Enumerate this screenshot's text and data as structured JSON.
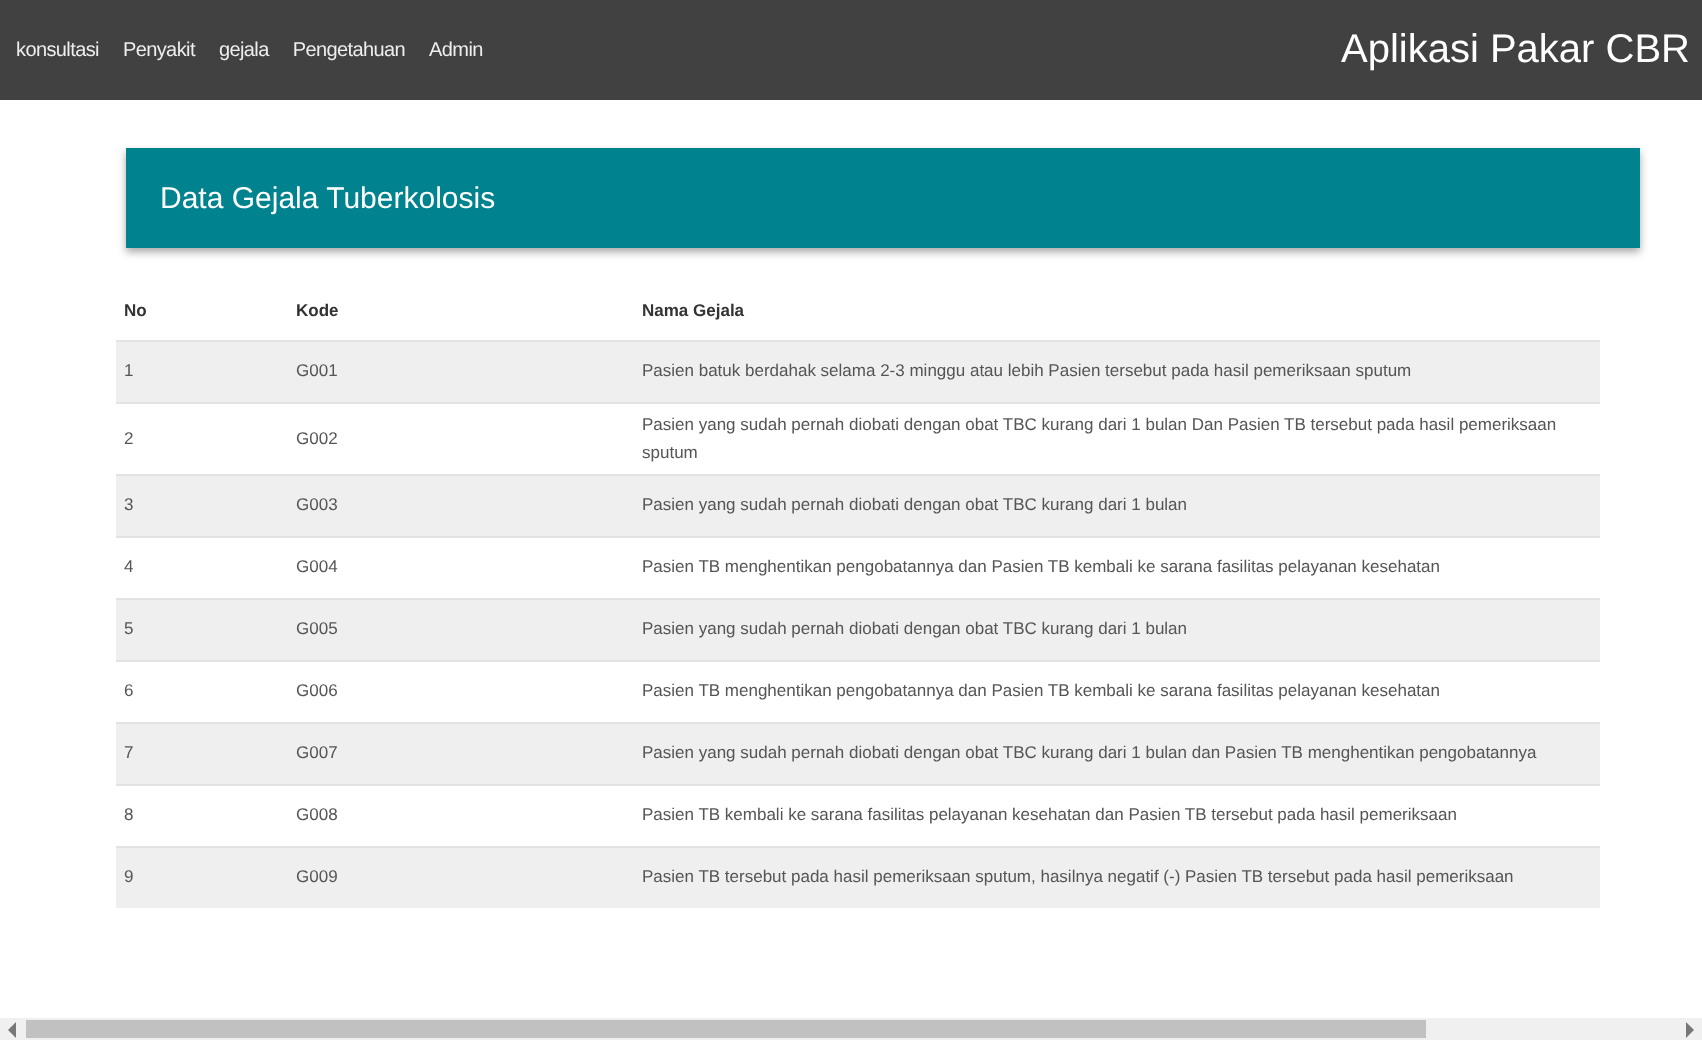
{
  "navbar": {
    "links": [
      {
        "label": "konsultasi"
      },
      {
        "label": "Penyakit"
      },
      {
        "label": "gejala"
      },
      {
        "label": "Pengetahuan"
      },
      {
        "label": "Admin"
      }
    ],
    "brand": "Aplikasi Pakar CBR"
  },
  "card": {
    "title": "Data Gejala Tuberkolosis"
  },
  "table": {
    "columns": [
      "No",
      "Kode",
      "Nama Gejala"
    ],
    "rows": [
      [
        "1",
        "G001",
        "Pasien batuk berdahak selama 2-3 minggu atau lebih Pasien tersebut pada hasil pemeriksaan sputum"
      ],
      [
        "2",
        "G002",
        "Pasien yang sudah pernah diobati dengan obat TBC kurang dari 1 bulan Dan Pasien TB tersebut pada hasil pemeriksaan sputum"
      ],
      [
        "3",
        "G003",
        "Pasien yang sudah pernah diobati dengan obat TBC kurang dari 1 bulan"
      ],
      [
        "4",
        "G004",
        "Pasien TB menghentikan pengobatannya dan Pasien TB kembali ke sarana fasilitas pelayanan kesehatan"
      ],
      [
        "5",
        "G005",
        "Pasien yang sudah pernah diobati dengan obat TBC kurang dari 1 bulan"
      ],
      [
        "6",
        "G006",
        "Pasien TB menghentikan pengobatannya dan Pasien TB kembali ke sarana fasilitas pelayanan kesehatan"
      ],
      [
        "7",
        "G007",
        "Pasien yang sudah pernah diobati dengan obat TBC kurang dari 1 bulan dan Pasien TB menghentikan pengobatannya"
      ],
      [
        "8",
        "G008",
        "Pasien TB kembali ke sarana fasilitas pelayanan kesehatan dan Pasien TB tersebut pada hasil pemeriksaan"
      ],
      [
        "9",
        "G009",
        "Pasien TB tersebut pada hasil pemeriksaan sputum, hasilnya negatif (-) Pasien TB tersebut pada hasil pemeriksaan"
      ]
    ]
  }
}
